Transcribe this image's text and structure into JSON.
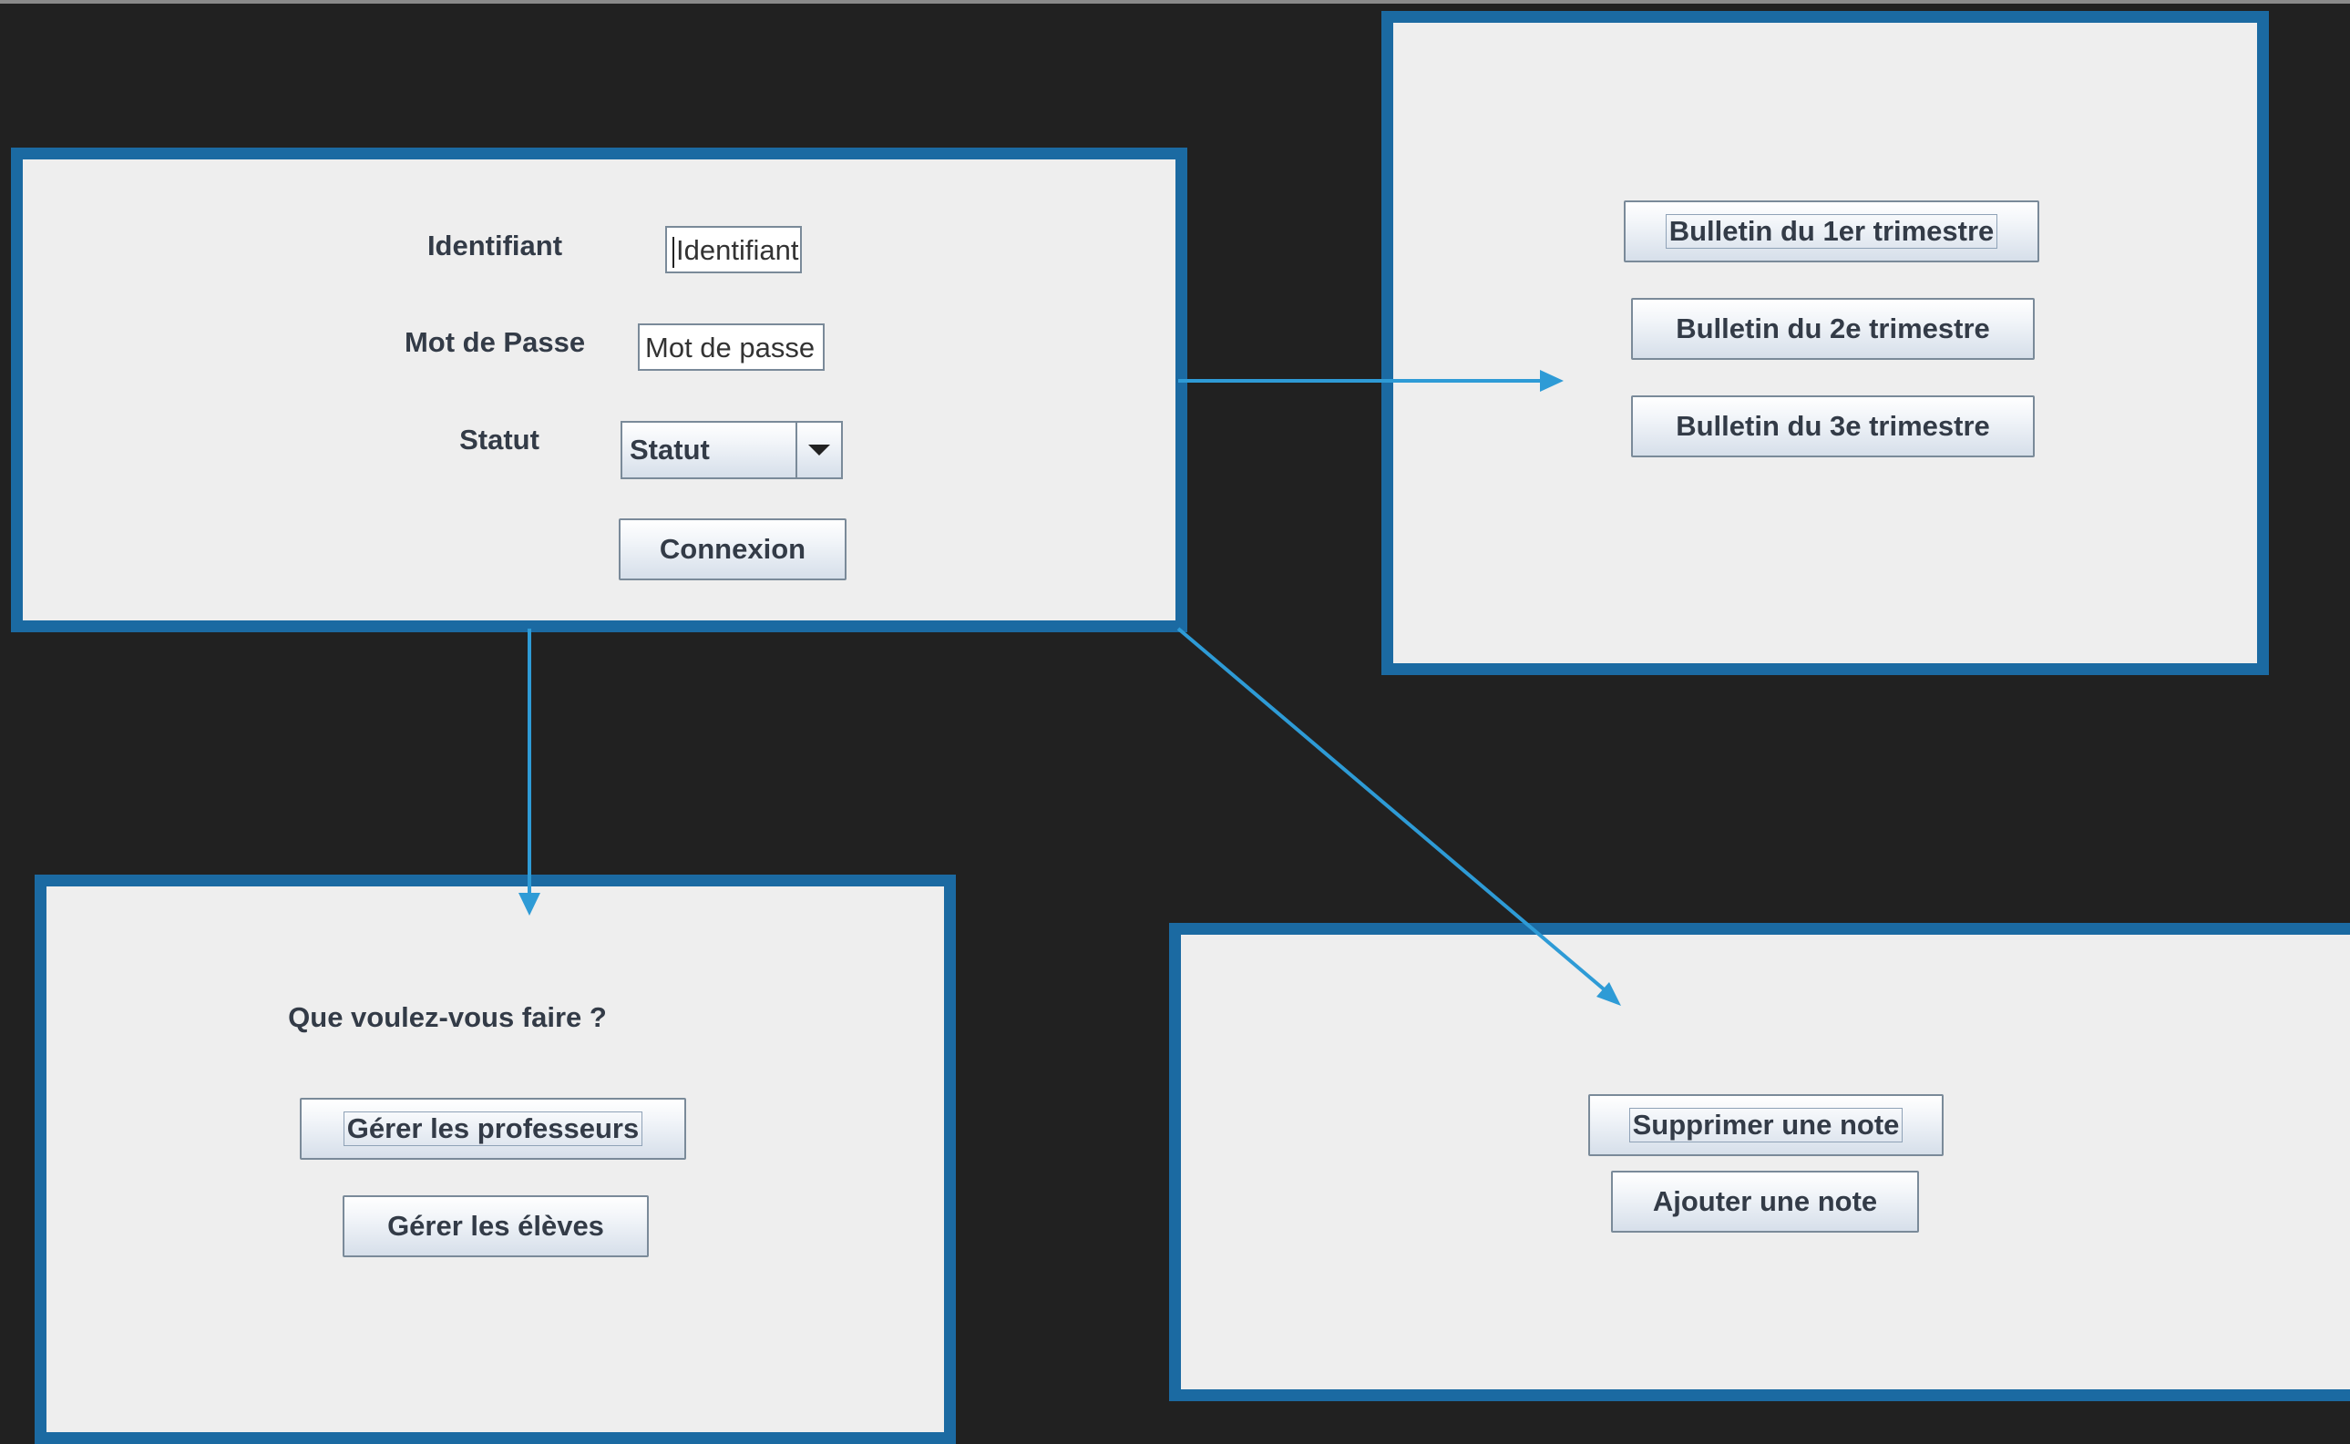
{
  "login": {
    "identifiant_label": "Identifiant",
    "identifiant_value": "Identifiant",
    "password_label": "Mot de Passe",
    "password_value": "Mot de passe",
    "statut_label": "Statut",
    "statut_selected": "Statut",
    "connect_label": "Connexion"
  },
  "bulletins": {
    "b1": "Bulletin du 1er trimestre",
    "b2": "Bulletin du 2e trimestre",
    "b3": "Bulletin du 3e trimestre"
  },
  "admin": {
    "question": "Que voulez-vous faire ?",
    "manage_teachers": "Gérer les professeurs",
    "manage_students": "Gérer les élèves"
  },
  "notes": {
    "delete_note": "Supprimer une note",
    "add_note": "Ajouter une note"
  },
  "colors": {
    "background": "#212121",
    "panel_border": "#1b6aa2",
    "panel_fill": "#eeeeee",
    "arrow": "#2e9bd6"
  }
}
